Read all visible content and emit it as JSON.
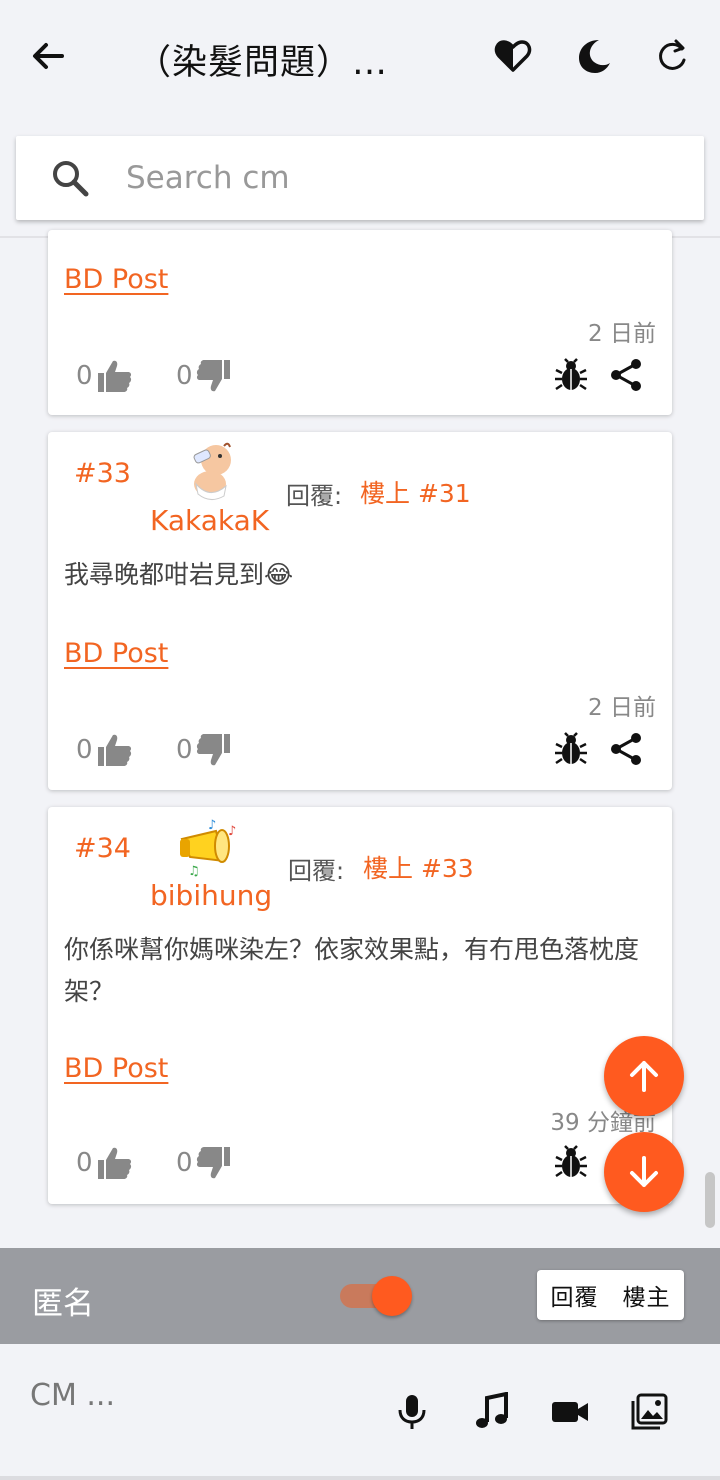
{
  "header": {
    "title": "（染髮問題）…",
    "back_icon": "arrow-left-icon",
    "favorite_icon": "heart-half-icon",
    "theme_icon": "moon-icon",
    "refresh_icon": "refresh-icon"
  },
  "search": {
    "placeholder": "Search cm",
    "value": ""
  },
  "posts": [
    {
      "link": "BD Post",
      "time": "2 日前",
      "likes": "0",
      "dislikes": "0"
    },
    {
      "number": "#33",
      "username": "KakakaK",
      "reply_label": "回覆:",
      "reply_target": "樓上 #31",
      "body": "我尋晚都咁岩見到😂",
      "link": "BD Post",
      "time": "2 日前",
      "likes": "0",
      "dislikes": "0"
    },
    {
      "number": "#34",
      "username": "bibihung",
      "reply_label": "回覆:",
      "reply_target": "樓上 #33",
      "body": "你係咪幫你媽咪染左？依家效果點，有冇甩色落枕度架？",
      "link": "BD Post",
      "time": "39 分鐘前",
      "likes": "0",
      "dislikes": "0"
    }
  ],
  "anon_bar": {
    "label": "匿名",
    "toggle_on": true,
    "reply_op_label": "回覆　樓主"
  },
  "composer": {
    "placeholder": "CM ...",
    "icons": [
      "microphone-icon",
      "music-note-icon",
      "video-camera-icon",
      "image-gallery-icon"
    ]
  },
  "colors": {
    "accent": "#f26522",
    "fab": "#ff5a1f",
    "bar_gray": "#9a9ca1",
    "background": "#f2f3f7"
  }
}
